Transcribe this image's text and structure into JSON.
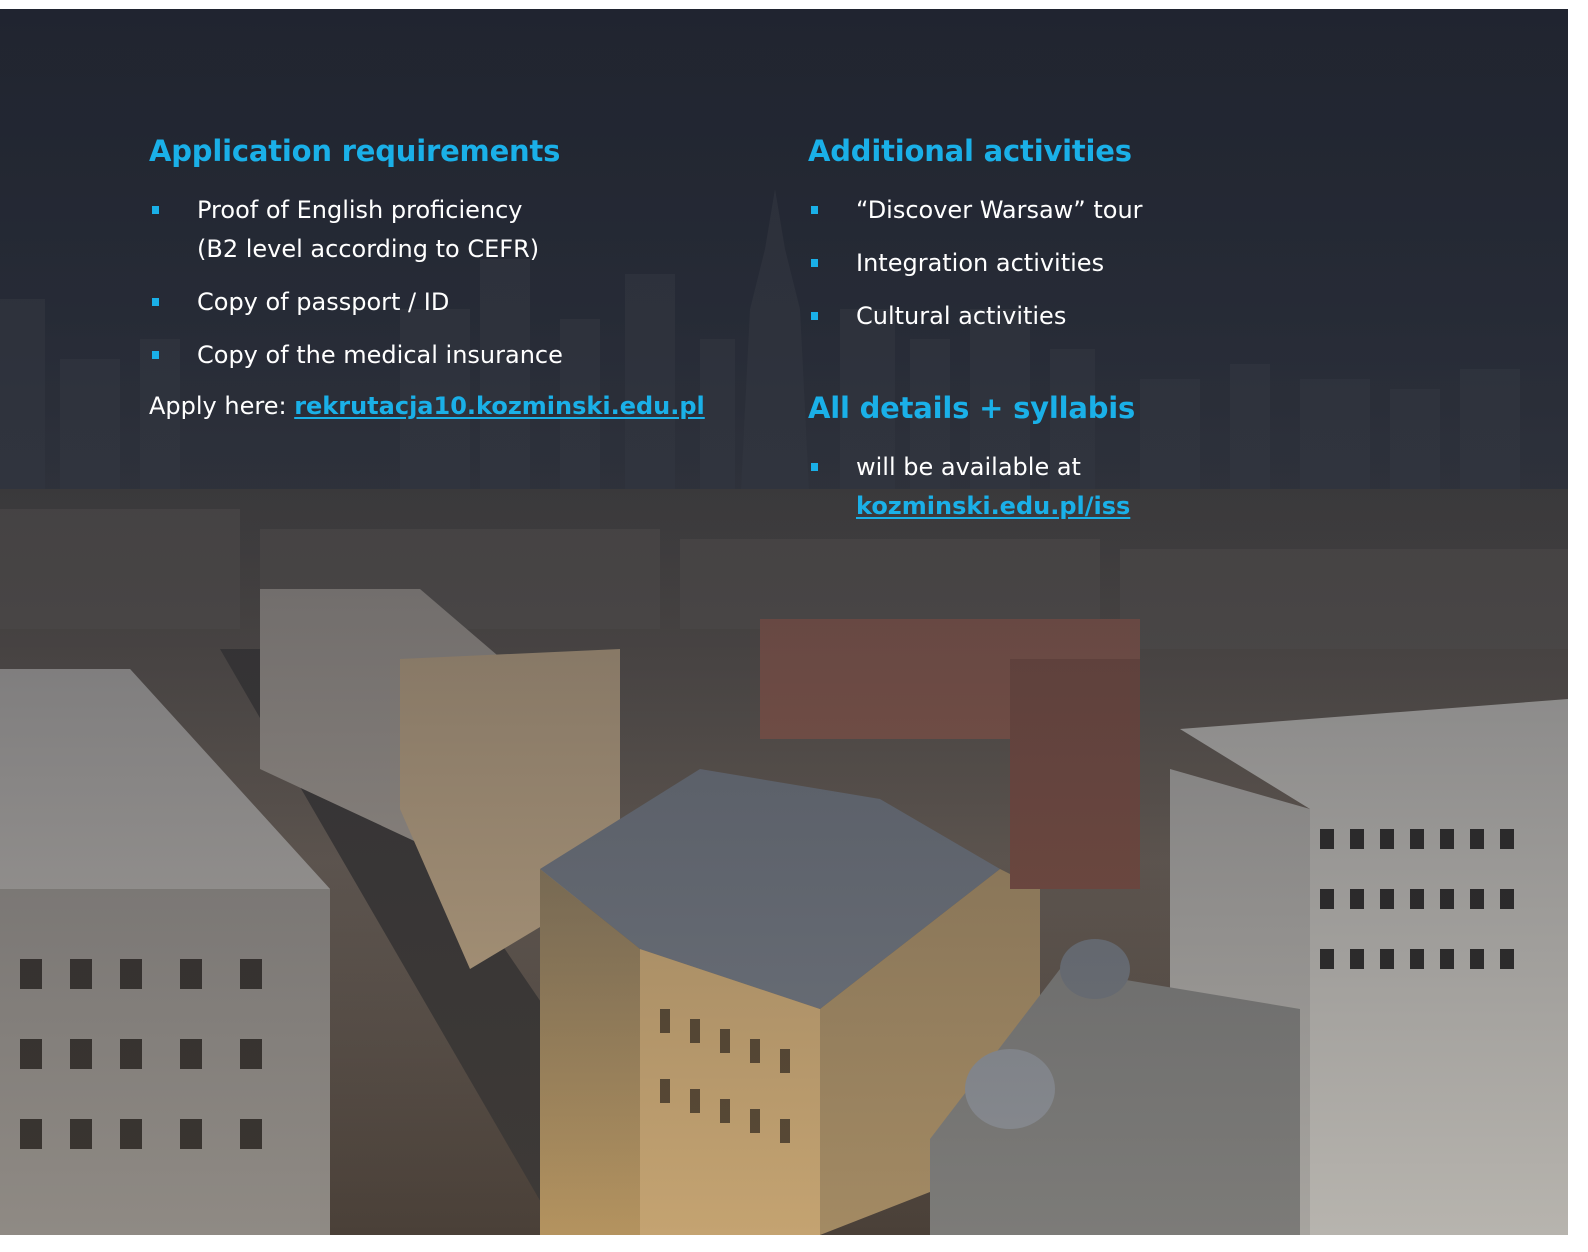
{
  "left": {
    "heading": "Application requirements",
    "items": [
      {
        "line1": "Proof of English proficiency",
        "line2": "(B2 level according to CEFR)"
      },
      {
        "line1": "Copy of passport / ID"
      },
      {
        "line1": "Copy of the medical insurance"
      }
    ],
    "apply_label": "Apply here: ",
    "apply_link": "rekrutacja10.kozminski.edu.pl"
  },
  "right": {
    "heading": "Additional activities",
    "items": [
      "“Discover Warsaw” tour",
      "Integration activities",
      "Cultural activities"
    ],
    "details_heading": "All details + syllabis",
    "details_text": "will be available at",
    "details_link": "kozminski.edu.pl/iss"
  },
  "colors": {
    "accent": "#1ab0e8",
    "text": "#ffffff",
    "background_dark": "#262a36"
  }
}
